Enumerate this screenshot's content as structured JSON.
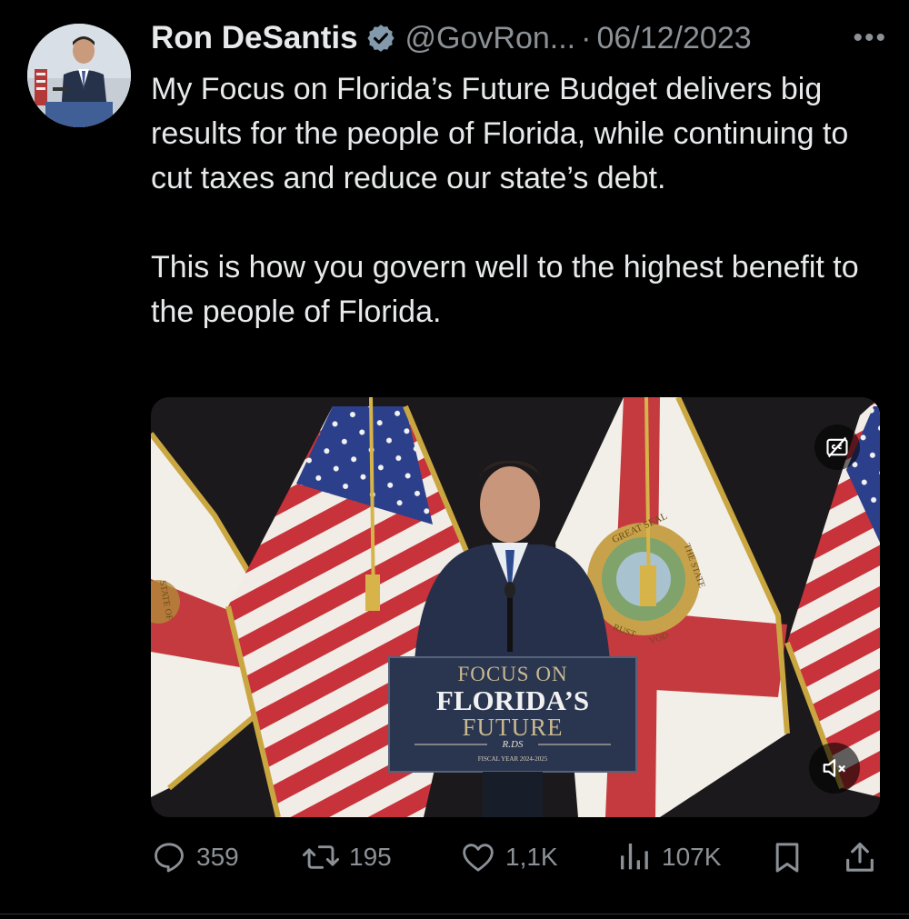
{
  "tweet": {
    "author_name": "Ron DeSantis",
    "handle": "@GovRon...",
    "separator": "·",
    "date": "06/12/2023",
    "more_label": "•••",
    "paragraphs": [
      "My Focus on Florida’s Future Budget delivers big results for the people of Florida, while continuing to cut taxes and reduce our state’s debt.",
      "This is how you govern well to the highest benefit to the people of Florida."
    ],
    "video": {
      "podium_line1": "FOCUS ON",
      "podium_line2": "FLORIDA’S",
      "podium_line3": "FUTURE",
      "podium_signature": "R.DS",
      "podium_subtitle": "FISCAL YEAR 2024-2025",
      "seal_top_text": "GREAT SEAL",
      "seal_right_text": "THE STATE",
      "seal_bottom_text": "RUST",
      "seal_bottom_right": "VOD",
      "left_flag_text": "STATE OF"
    },
    "actions": {
      "replies": "359",
      "retweets": "195",
      "likes": "1,1K",
      "views": "107K"
    }
  },
  "colors": {
    "background": "#000000",
    "text": "#e7e9ea",
    "muted": "#8b9196",
    "verified": "#829aab"
  },
  "icons": [
    "verified-badge-icon",
    "more-icon",
    "closed-captions-icon",
    "mute-icon",
    "reply-icon",
    "retweet-icon",
    "like-icon",
    "views-icon",
    "bookmark-icon",
    "share-icon"
  ]
}
